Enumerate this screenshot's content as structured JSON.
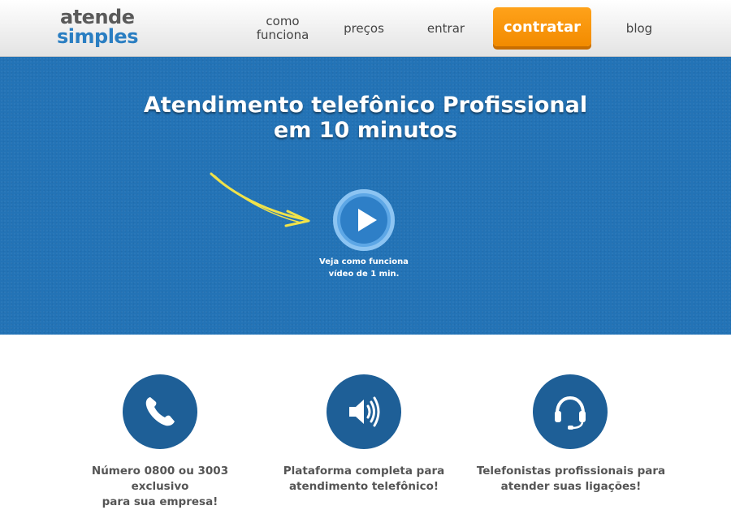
{
  "brand": {
    "logo_line1": "atende",
    "logo_line2": "simples",
    "colors": {
      "primary_blue": "#2373b6",
      "accent_orange": "#f7941d",
      "logo_gray": "#5a5a5a",
      "logo_blue": "#2a7ec2"
    }
  },
  "nav": {
    "items": [
      {
        "label_line1": "como",
        "label_line2": "funciona"
      },
      {
        "label": "preços"
      },
      {
        "label": "entrar"
      },
      {
        "label": "contratar"
      },
      {
        "label": "blog"
      }
    ]
  },
  "hero": {
    "title_line1": "Atendimento telefônico Profissional",
    "title_line2": "em 10 minutos",
    "video_caption_line1": "Veja como funciona",
    "video_caption_line2": "vídeo de 1 min.",
    "icons": {
      "arrow": "hand-drawn-arrow-icon",
      "play": "play-icon"
    }
  },
  "features": [
    {
      "icon": "phone-icon",
      "line1": "Número 0800 ou 3003 exclusivo",
      "line2": "para sua empresa!"
    },
    {
      "icon": "speaker-icon",
      "line1": "Plataforma completa para",
      "line2": "atendimento telefônico!"
    },
    {
      "icon": "headset-icon",
      "line1": "Telefonistas profissionais para",
      "line2": "atender suas ligações!"
    }
  ]
}
